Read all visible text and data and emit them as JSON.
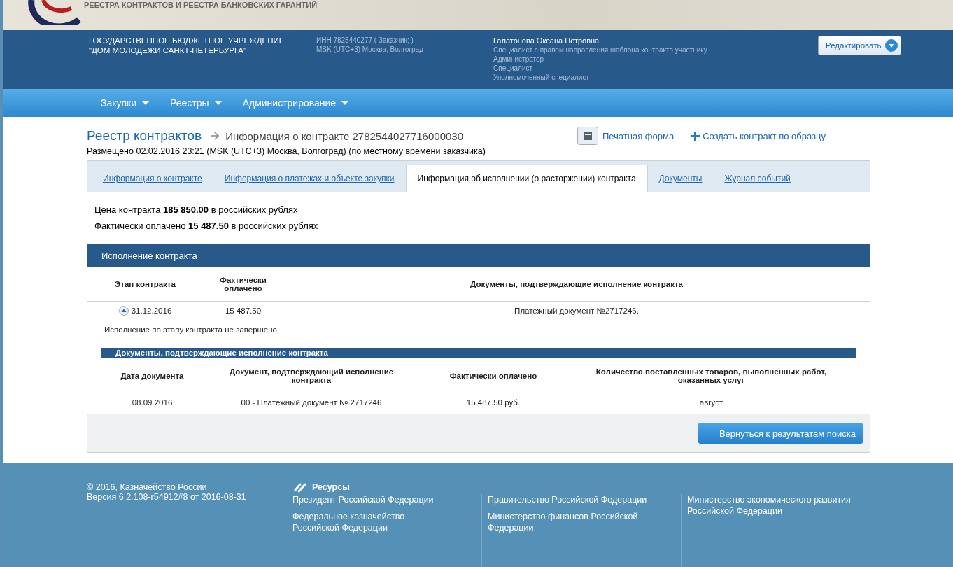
{
  "banner": {
    "subtitle": "РЕЕСТРА КОНТРАКТОВ И РЕЕСТРА БАНКОВСКИХ ГАРАНТИЙ"
  },
  "header": {
    "org": [
      "ГОСУДАРСТВЕННОЕ БЮДЖЕТНОЕ УЧРЕЖДЕНИЕ",
      "\"ДОМ МОЛОДЕЖИ САНКТ-ПЕТЕРБУРГА\""
    ],
    "org_info": [
      "ИНН 7825440277 ( Заказчик; )",
      "MSK (UTC+3) Москва, Волгоград"
    ],
    "user": "Галатонова Оксана Петровна",
    "roles": [
      "Специалист с правом направления шаблона контракта участнику",
      "Администратор",
      "Специалист",
      "Уполномоченный специалист"
    ],
    "edit_button": "Редактировать"
  },
  "nav": [
    "Закупки",
    "Реестры",
    "Администрирование"
  ],
  "breadcrumb": {
    "root": "Реестр контрактов",
    "current": "Информация о контракте 2782544027716000030"
  },
  "actions": {
    "print": "Печатная форма",
    "create": "Создать контракт по образцу"
  },
  "posted": "Размещено 02.02.2016 23:21 (MSK (UTC+3) Москва, Волгоград) (по местному времени заказчика)",
  "tabs": [
    {
      "label": "Информация о контракте",
      "selected": false
    },
    {
      "label": "Информация о платежах и объекте закупки",
      "selected": false
    },
    {
      "label": "Информация об исполнении (о расторжении) контракта",
      "selected": true
    },
    {
      "label": "Документы",
      "selected": false
    },
    {
      "label": "Журнал событий",
      "selected": false
    }
  ],
  "summary": [
    "Цена контракта **185 850.00** в российских рублях",
    "Фактически оплачено **15 487.50** в российских рублях"
  ],
  "execution": {
    "title": "Исполнение контракта",
    "columns": [
      "Этап контракта",
      "Фактически оплачено",
      "Документы, подтверждающие исполнение контракта"
    ],
    "stage": {
      "date": "31.12.2016",
      "paid": "15 487.50",
      "documents": "Платежный документ №2717246.",
      "expanded": true,
      "status": "Исполнение по этапу контракта не завершено"
    },
    "docs_title": "Документы, подтверждающие исполнение контракта",
    "doc_columns": [
      "Дата документа",
      "Документ, подтверждающий исполнение контракта",
      "Фактически оплачено",
      "Количество поставленных товаров, выполненных работ, оказанных услуг"
    ],
    "doc_rows": [
      [
        "08.09.2016",
        "00 - Платежный документ № 2717246",
        "15 487.50 руб.",
        "август"
      ]
    ]
  },
  "back_button": "Вернуться к результатам поиска",
  "footer": {
    "copyright": [
      "© 2016, Казначейство России",
      "Версия 6.2.108-r54912#8 от 2016-08-31"
    ],
    "resources_title": "Ресурсы",
    "columns": [
      [
        "Президент Российской Федерации",
        "Федеральное казначейство Российской Федерации"
      ],
      [
        "Правительство Российской Федерации",
        "Министерство финансов Российской Федерации"
      ],
      [
        "Министерство экономического развития Российской Федерации"
      ]
    ]
  }
}
